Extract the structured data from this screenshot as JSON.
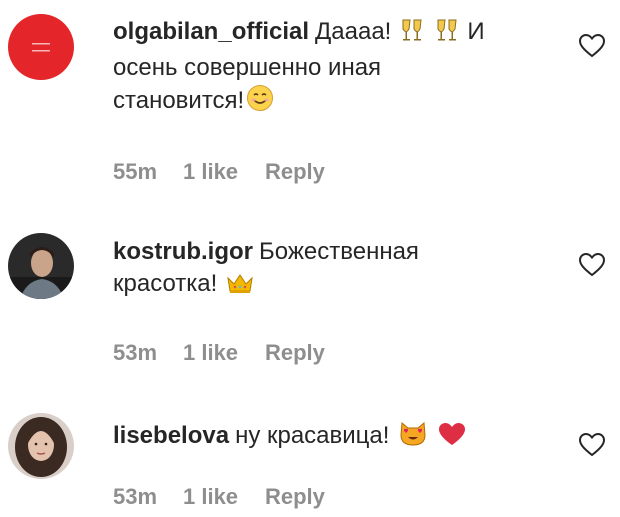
{
  "comments": [
    {
      "username": "olgabilan_official",
      "text_line1": "Дaaaa!",
      "text_line1_after": "И",
      "text_line2": "осень совершенно иная",
      "text_line3": "становится!",
      "emoji_a": "clinking-glasses",
      "emoji_b": "smiling-face",
      "time": "55m",
      "likes": "1 like",
      "reply": "Reply",
      "avatar_color": "#e4262b"
    },
    {
      "username": "kostrub.igor",
      "text_line1": "Божественная",
      "text_line2": "красотка!",
      "emoji_a": "crown",
      "time": "53m",
      "likes": "1 like",
      "reply": "Reply"
    },
    {
      "username": "lisebelova",
      "text_line1": "ну красавица!",
      "emoji_a": "heart-eyes-cat",
      "emoji_b": "red-heart",
      "time": "53m",
      "likes": "1 like",
      "reply": "Reply"
    }
  ],
  "colors": {
    "text": "#262626",
    "meta": "#8e8e8e",
    "heart_outline": "#262626"
  }
}
